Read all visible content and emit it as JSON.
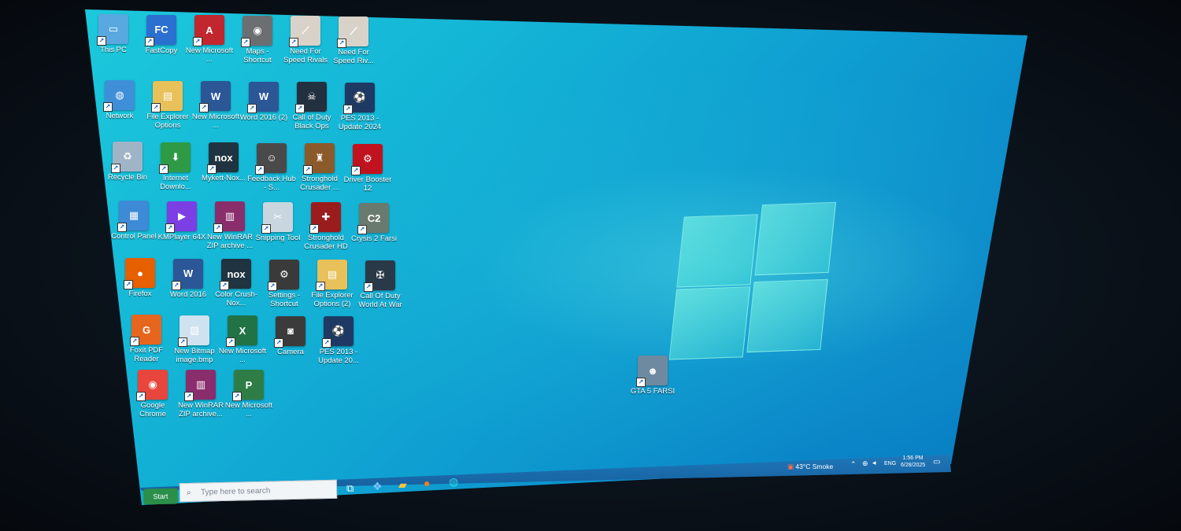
{
  "desktop": {
    "icons": [
      {
        "label": "This PC",
        "color": "#5aa8e0",
        "glyph": "▭"
      },
      {
        "label": "FastCopy",
        "color": "#2b6fd0",
        "glyph": "FC"
      },
      {
        "label": "New Microsoft ...",
        "color": "#c2262e",
        "glyph": "A"
      },
      {
        "label": "Maps - Shortcut",
        "color": "#6c6f72",
        "glyph": "◉"
      },
      {
        "label": "Need For Speed Rivals",
        "color": "#d9d2c8",
        "glyph": "⟋"
      },
      {
        "label": "Need For Speed Riv...",
        "color": "#d9d2c8",
        "glyph": "⟋"
      },
      {
        "label": "Network",
        "color": "#3f8fd8",
        "glyph": "◍"
      },
      {
        "label": "File Explorer Options",
        "color": "#e8c15a",
        "glyph": "▤"
      },
      {
        "label": "New Microsoft ...",
        "color": "#2b5797",
        "glyph": "W"
      },
      {
        "label": "Word 2016 (2)",
        "color": "#2b5797",
        "glyph": "W"
      },
      {
        "label": "Call of Duty Black Ops",
        "color": "#233040",
        "glyph": "☠"
      },
      {
        "label": "PES 2013 - Update 2024",
        "color": "#1e3a64",
        "glyph": "⚽"
      },
      {
        "label": "Recycle Bin",
        "color": "#9fb4c6",
        "glyph": "♻"
      },
      {
        "label": "Internet Downlo...",
        "color": "#2e9a45",
        "glyph": "⬇"
      },
      {
        "label": "Mykett-Nox...",
        "color": "#1f3440",
        "glyph": "nox"
      },
      {
        "label": "Feedback Hub - S...",
        "color": "#4a4a4a",
        "glyph": "☺"
      },
      {
        "label": "Stronghold Crusader ...",
        "color": "#8b5a2b",
        "glyph": "♜"
      },
      {
        "label": "Driver Booster 12",
        "color": "#c1121f",
        "glyph": "⚙"
      },
      {
        "label": "Control Panel",
        "color": "#3d8ad6",
        "glyph": "▦"
      },
      {
        "label": "KMPlayer 64X",
        "color": "#7b3fe4",
        "glyph": "▶"
      },
      {
        "label": "New WinRAR ZIP archive ...",
        "color": "#8a2d6d",
        "glyph": "▥"
      },
      {
        "label": "Snipping Tool",
        "color": "#c9d6e0",
        "glyph": "✂"
      },
      {
        "label": "Stronghold Crusader HD",
        "color": "#9b1c1c",
        "glyph": "✚"
      },
      {
        "label": "Crysis 2 Farsi",
        "color": "#6b7a6e",
        "glyph": "C2"
      },
      {
        "label": "Firefox",
        "color": "#e66000",
        "glyph": "●"
      },
      {
        "label": "Word 2016",
        "color": "#2b5797",
        "glyph": "W"
      },
      {
        "label": "Color Crush-Nox...",
        "color": "#1f3440",
        "glyph": "nox"
      },
      {
        "label": "Settings - Shortcut",
        "color": "#3a3a3a",
        "glyph": "⚙"
      },
      {
        "label": "File Explorer Options (2)",
        "color": "#e8c15a",
        "glyph": "▤"
      },
      {
        "label": "Call Of Duty World At War",
        "color": "#2a3948",
        "glyph": "✠"
      },
      {
        "label": "Foxit PDF Reader",
        "color": "#e7661e",
        "glyph": "G"
      },
      {
        "label": "New Bitmap image.bmp",
        "color": "#cfe2ef",
        "glyph": "▨"
      },
      {
        "label": "New Microsoft ...",
        "color": "#217346",
        "glyph": "X"
      },
      {
        "label": "Camera",
        "color": "#3b3b3b",
        "glyph": "◙"
      },
      {
        "label": "PES 2013 - Update 20...",
        "color": "#1e3a64",
        "glyph": "⚽"
      },
      {
        "label": "Google Chrome",
        "color": "#e8453c",
        "glyph": "◉"
      },
      {
        "label": "New WinRAR ZIP archive...",
        "color": "#8a2d6d",
        "glyph": "▥"
      },
      {
        "label": "New Microsoft ...",
        "color": "#2f7d46",
        "glyph": "P"
      },
      {
        "label": "GTA 5 FARSI",
        "color": "#6d8aa0",
        "glyph": "☻"
      }
    ]
  },
  "taskbar": {
    "start_label": "Start",
    "search_placeholder": "Type here to search",
    "weather": "43°C  Smoke",
    "language": "ENG",
    "time": "1:56 PM",
    "date": "6/28/2025"
  },
  "colors": {
    "accent": "#14b5d6",
    "taskbar": "#1f77b8"
  }
}
